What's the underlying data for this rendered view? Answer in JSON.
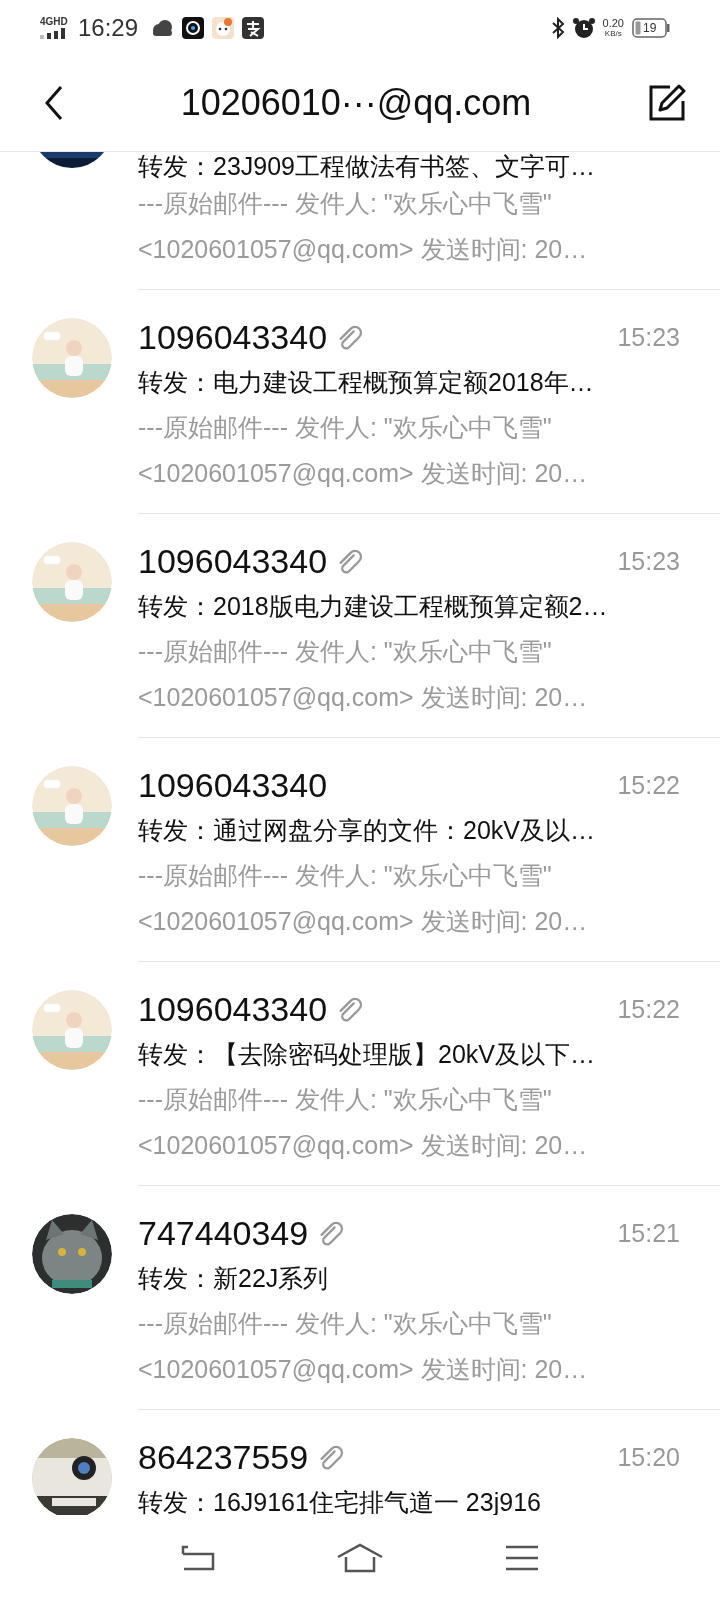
{
  "status_bar": {
    "network": "4GHD",
    "time": "16:29",
    "speed_value": "0.20",
    "speed_unit": "KB/s",
    "battery": "19"
  },
  "header": {
    "title": "10206010···@qq.com"
  },
  "messages": [
    {
      "subject": "转发：23J909工程做法有书签、文字可…",
      "preview": [
        "---原始邮件--- 发件人: \"欢乐心中飞雪\"",
        "<1020601057@qq.com> 发送时间: 20…"
      ]
    },
    {
      "sender": "1096043340",
      "attachment": true,
      "time": "15:23",
      "subject": "转发：电力建设工程概预算定额2018年…",
      "preview": [
        "---原始邮件--- 发件人: \"欢乐心中飞雪\"",
        "<1020601057@qq.com> 发送时间: 20…"
      ]
    },
    {
      "sender": "1096043340",
      "attachment": true,
      "time": "15:23",
      "subject": "转发：2018版电力建设工程概预算定额2…",
      "preview": [
        "---原始邮件--- 发件人: \"欢乐心中飞雪\"",
        "<1020601057@qq.com> 发送时间: 20…"
      ]
    },
    {
      "sender": "1096043340",
      "attachment": false,
      "time": "15:22",
      "subject": "转发：通过网盘分享的文件：20kV及以…",
      "preview": [
        "---原始邮件--- 发件人: \"欢乐心中飞雪\"",
        "<1020601057@qq.com> 发送时间: 20…"
      ]
    },
    {
      "sender": "1096043340",
      "attachment": true,
      "time": "15:22",
      "subject": "转发：【去除密码处理版】20kV及以下…",
      "preview": [
        "---原始邮件--- 发件人: \"欢乐心中飞雪\"",
        "<1020601057@qq.com> 发送时间: 20…"
      ]
    },
    {
      "sender": "747440349",
      "attachment": true,
      "time": "15:21",
      "subject": "转发：新22J系列",
      "preview": [
        "---原始邮件--- 发件人: \"欢乐心中飞雪\"",
        "<1020601057@qq.com> 发送时间: 20…"
      ]
    },
    {
      "sender": "864237559",
      "attachment": true,
      "time": "15:20",
      "subject": "转发：16J9161住宅排气道一 23j916"
    }
  ]
}
